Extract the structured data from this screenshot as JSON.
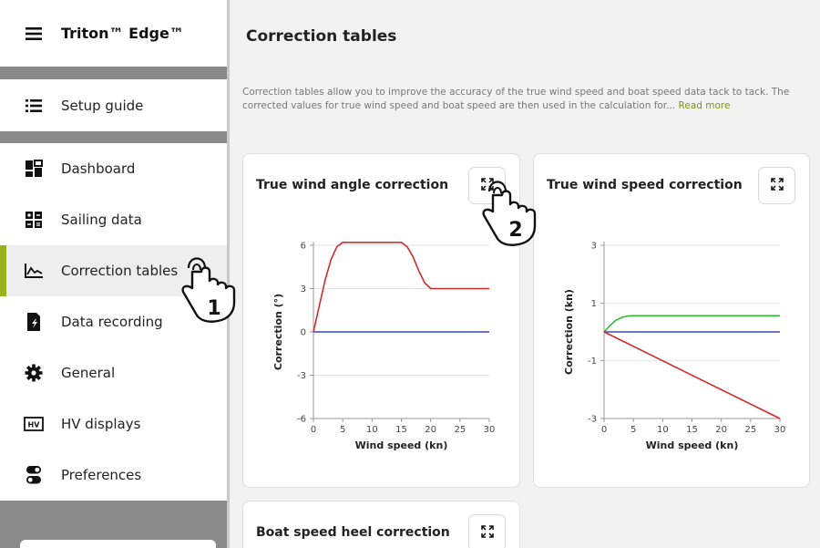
{
  "app": {
    "title": "Triton™ Edge™"
  },
  "sidebar": {
    "setup": "Setup guide",
    "items": [
      {
        "label": "Dashboard",
        "icon": "dashboard-icon"
      },
      {
        "label": "Sailing data",
        "icon": "sailing-data-icon"
      },
      {
        "label": "Correction tables",
        "icon": "correction-tables-icon",
        "active": true
      },
      {
        "label": "Data recording",
        "icon": "data-recording-icon"
      },
      {
        "label": "General",
        "icon": "gear-icon"
      },
      {
        "label": "HV displays",
        "icon": "hv-displays-icon"
      },
      {
        "label": "Preferences",
        "icon": "toggle-icon"
      }
    ],
    "hv_icon_text": "HV"
  },
  "main": {
    "title": "Correction tables",
    "description": "Correction tables allow you to improve the accuracy of the true wind speed and boat speed data tack to tack. The corrected values for true wind speed and boat speed are then used in the calculation for...",
    "read_more": "Read more",
    "cards": [
      {
        "title": "True wind angle correction"
      },
      {
        "title": "True wind speed correction"
      },
      {
        "title": "Boat speed heel correction"
      }
    ]
  },
  "callouts": {
    "one": "1",
    "two": "2"
  },
  "colors": {
    "accent": "#97b21f",
    "red": "#d42a2a",
    "blue": "#3344dd",
    "green": "#33b833"
  },
  "chart_data": [
    {
      "type": "line",
      "title": "True wind angle correction",
      "xlabel": "Wind speed (kn)",
      "ylabel": "Correction (°)",
      "xlim": [
        0,
        30
      ],
      "ylim": [
        -6,
        6
      ],
      "xticks": [
        0,
        5,
        10,
        15,
        20,
        25,
        30
      ],
      "yticks": [
        6,
        3,
        0,
        -3,
        -6
      ],
      "series": [
        {
          "color": "#d42a2a",
          "x": [
            0,
            1,
            2,
            3,
            4,
            5,
            15,
            16,
            17,
            18,
            19,
            20,
            30
          ],
          "y": [
            0,
            1.8,
            3.6,
            5.0,
            5.9,
            6.2,
            6.2,
            5.9,
            5.2,
            4.2,
            3.4,
            3.0,
            3.0
          ]
        },
        {
          "color": "#3344dd",
          "x": [
            0,
            30
          ],
          "y": [
            0,
            0
          ]
        }
      ]
    },
    {
      "type": "line",
      "title": "True wind speed correction",
      "xlabel": "Wind speed (kn)",
      "ylabel": "Correction (kn)",
      "xlim": [
        0,
        30
      ],
      "ylim": [
        -3,
        3
      ],
      "xticks": [
        0,
        5,
        10,
        15,
        20,
        25,
        30
      ],
      "yticks": [
        3,
        1,
        -1,
        -3
      ],
      "series": [
        {
          "color": "#33b833",
          "x": [
            0,
            1,
            2,
            3,
            4,
            5,
            30
          ],
          "y": [
            0,
            0.22,
            0.4,
            0.5,
            0.55,
            0.56,
            0.56
          ]
        },
        {
          "color": "#3344dd",
          "x": [
            0,
            30
          ],
          "y": [
            0,
            0
          ]
        },
        {
          "color": "#d42a2a",
          "x": [
            0,
            30
          ],
          "y": [
            0,
            -3
          ]
        }
      ]
    }
  ]
}
